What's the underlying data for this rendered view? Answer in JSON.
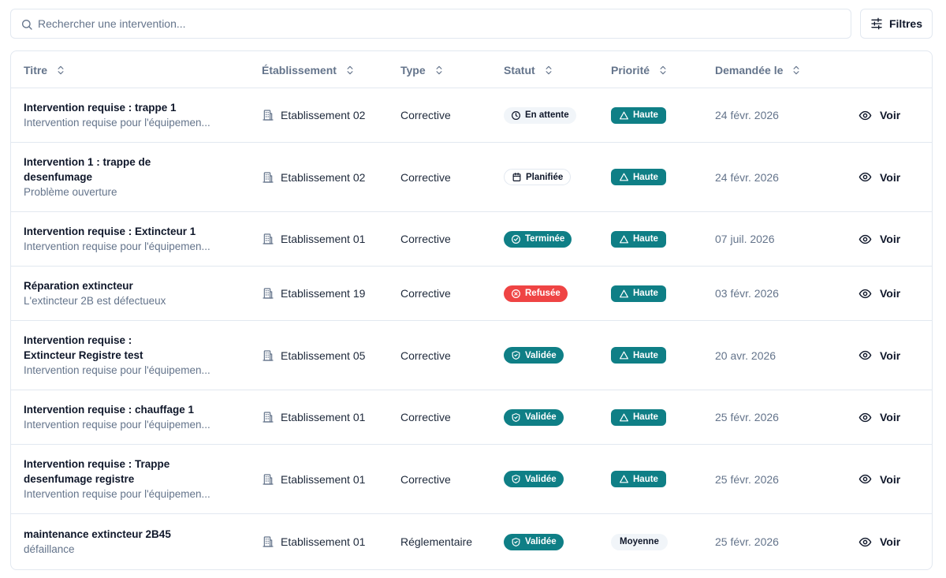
{
  "search": {
    "placeholder": "Rechercher une intervention..."
  },
  "toolbar": {
    "filters_label": "Filtres"
  },
  "columns": {
    "title": "Titre",
    "etablissement": "Établissement",
    "type": "Type",
    "statut": "Statut",
    "priorite": "Priorité",
    "date": "Demandée le"
  },
  "rows": [
    {
      "title": "Intervention requise : trappe 1",
      "subtitle": "Intervention requise pour l'équipemen...",
      "etablissement": "Etablissement 02",
      "type": "Corrective",
      "status": "En attente",
      "status_icon": "clock-icon",
      "priority": "Haute",
      "date": "24 févr. 2026",
      "action": "Voir"
    },
    {
      "title": "Intervention 1 : trappe de desenfumage",
      "subtitle": "Problème ouverture",
      "etablissement": "Etablissement 02",
      "type": "Corrective",
      "status": "Planifiée",
      "status_icon": "calendar-icon",
      "priority": "Haute",
      "date": "24 févr. 2026",
      "action": "Voir"
    },
    {
      "title": "Intervention requise : Extincteur 1",
      "subtitle": "Intervention requise pour l'équipemen...",
      "etablissement": "Etablissement 01",
      "type": "Corrective",
      "status": "Terminée",
      "status_icon": "check-circle-icon",
      "priority": "Haute",
      "date": "07 juil. 2026",
      "action": "Voir"
    },
    {
      "title": "Réparation extincteur",
      "subtitle": "L'extincteur 2B est défectueux",
      "etablissement": "Etablissement 19",
      "type": "Corrective",
      "status": "Refusée",
      "status_icon": "x-circle-icon",
      "priority": "Haute",
      "date": "03 févr. 2026",
      "action": "Voir"
    },
    {
      "title": "Intervention requise : Extincteur Registre test",
      "subtitle": "Intervention requise pour l'équipemen...",
      "etablissement": "Etablissement 05",
      "type": "Corrective",
      "status": "Validée",
      "status_icon": "shield-check-icon",
      "priority": "Haute",
      "date": "20 avr. 2026",
      "action": "Voir"
    },
    {
      "title": "Intervention requise : chauffage 1",
      "subtitle": "Intervention requise pour l'équipemen...",
      "etablissement": "Etablissement 01",
      "type": "Corrective",
      "status": "Validée",
      "status_icon": "shield-check-icon",
      "priority": "Haute",
      "date": "25 févr. 2026",
      "action": "Voir"
    },
    {
      "title": "Intervention requise : Trappe desenfumage registre",
      "subtitle": "Intervention requise pour l'équipemen...",
      "etablissement": "Etablissement 01",
      "type": "Corrective",
      "status": "Validée",
      "status_icon": "shield-check-icon",
      "priority": "Haute",
      "date": "25 févr. 2026",
      "action": "Voir"
    },
    {
      "title": "maintenance extincteur 2B45",
      "subtitle": "défaillance",
      "etablissement": "Etablissement 01",
      "type": "Réglementaire",
      "status": "Validée",
      "status_icon": "shield-check-icon",
      "priority": "Moyenne",
      "date": "25 févr. 2026",
      "action": "Voir"
    }
  ],
  "colors": {
    "accent_teal": "#0f7f86",
    "danger_red": "#ef4444",
    "muted_text": "#64748b",
    "border": "#e2e8f0"
  }
}
